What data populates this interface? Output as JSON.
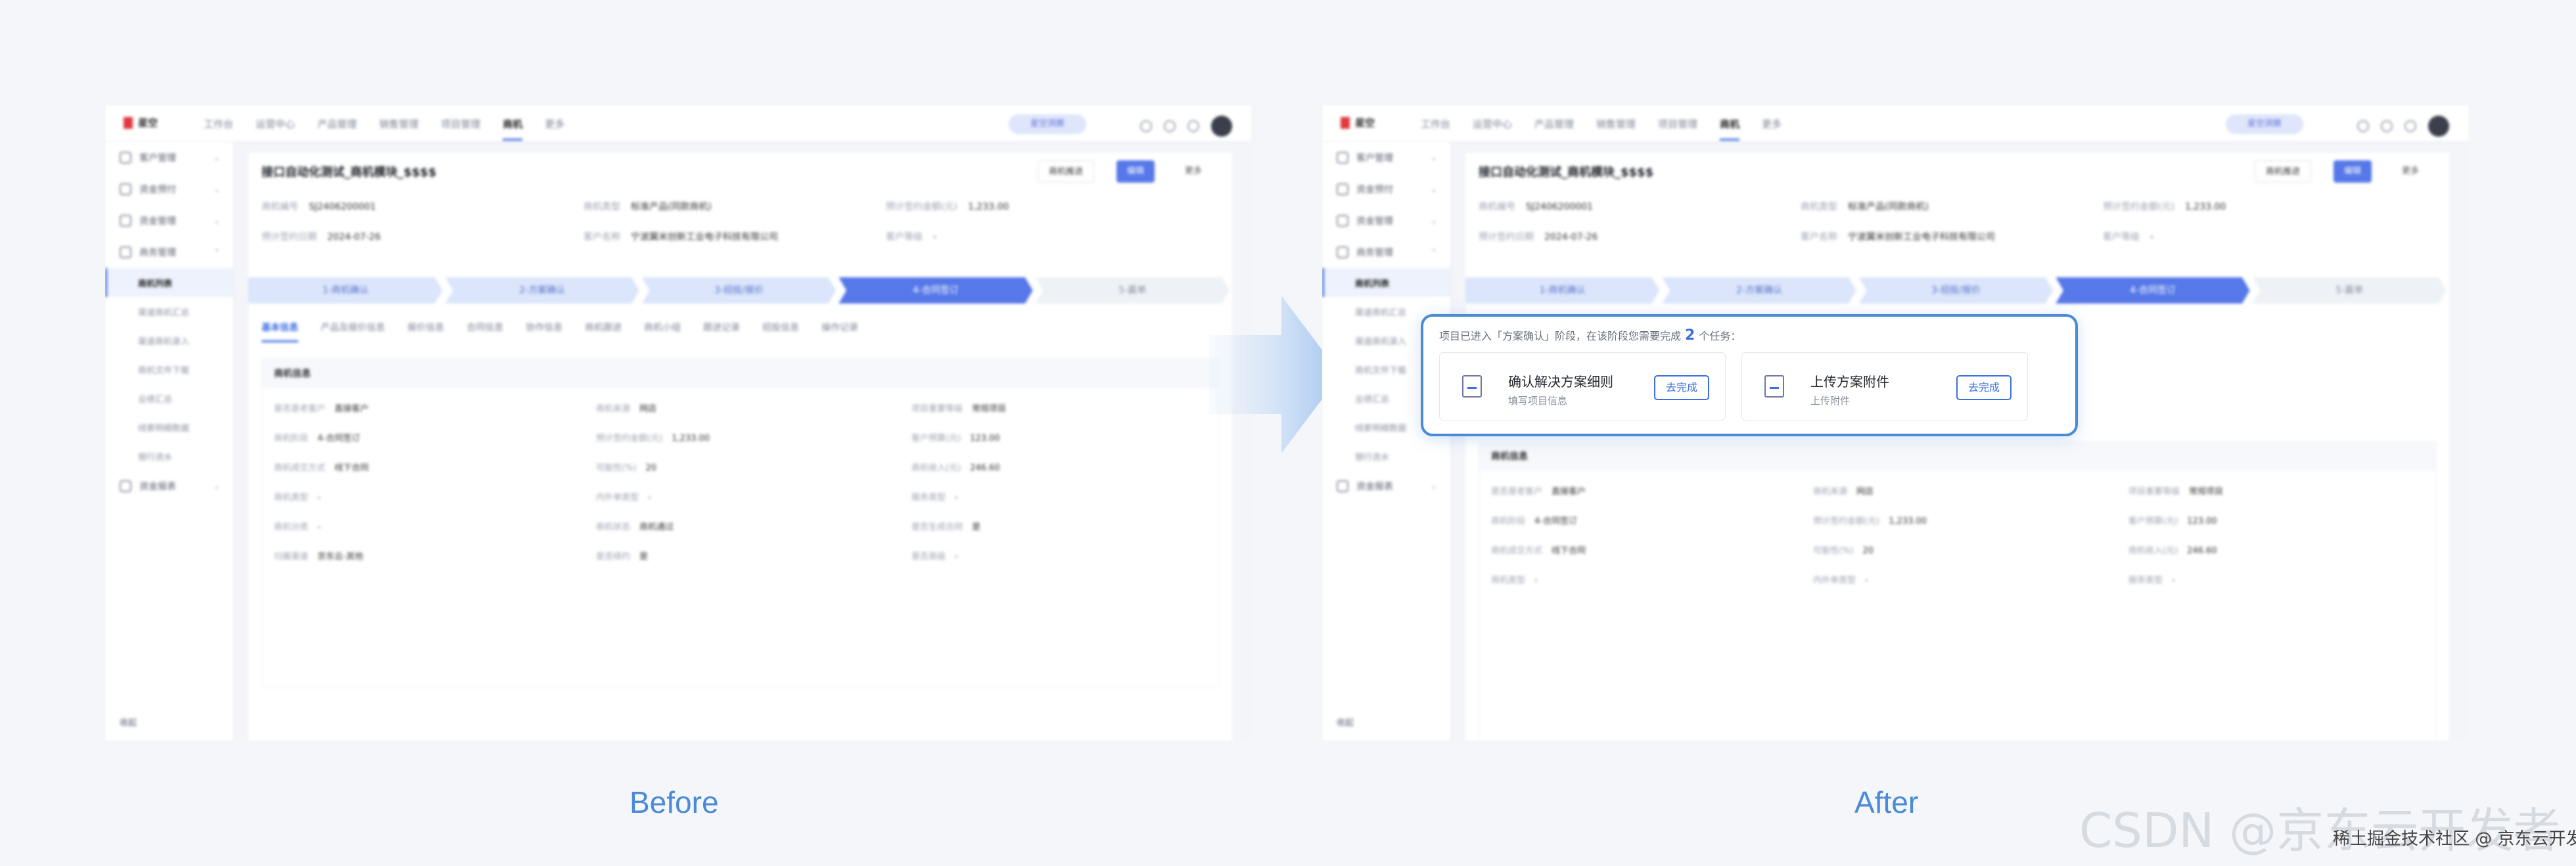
{
  "app": {
    "logo_text": "星空",
    "nav": [
      "工作台",
      "运营中心",
      "产品管理",
      "销售管理",
      "项目管理",
      "商机",
      "更多"
    ],
    "nav_active_index": 5,
    "top_badge": "星空洞察",
    "avatar_icon": "avatar",
    "top_icons": [
      "bell-icon",
      "help-icon",
      "settings-icon"
    ]
  },
  "sidebar": {
    "items": [
      {
        "label": "客户管理",
        "icon": "user-icon"
      },
      {
        "label": "资金预付",
        "icon": "wallet-icon"
      },
      {
        "label": "资金管理",
        "icon": "money-icon"
      },
      {
        "label": "商务管理",
        "icon": "briefcase-icon"
      }
    ],
    "subitems": [
      "商机列表",
      "渠道商机汇总",
      "渠道商机录入",
      "商机文件下载",
      "业绩汇总",
      "线索明细数据",
      "银行流水"
    ],
    "subitems_active_index": 0,
    "extra_item": {
      "label": "资金报表",
      "icon": "report-icon"
    },
    "footer": "收起"
  },
  "detail": {
    "title": "接口自动化测试_商机模块_$$$$",
    "buttons": [
      "商机推进",
      "编辑",
      "更多"
    ],
    "info": [
      {
        "label": "商机编号",
        "value": "SJ2406200001"
      },
      {
        "label": "商机类型",
        "value": "标准产品(同款商机)"
      },
      {
        "label": "预计签约金额(元)",
        "value": "1,233.00"
      },
      {
        "label": "预计签约日期",
        "value": "2024-07-26"
      },
      {
        "label": "客户名称",
        "value": "宁波翼米创新工业电子科技有限公司"
      },
      {
        "label": "客户等级",
        "value": "-"
      }
    ],
    "steps": [
      "1-商机确认",
      "2-方案确认",
      "3-招投/报价",
      "4-合同签订",
      "5-赢单"
    ],
    "current_step_index": 3,
    "tabs": [
      "基本信息",
      "产品及报价信息",
      "报价信息",
      "合同信息",
      "协作信息",
      "商机跟进",
      "商机小组",
      "跟进记录",
      "招投信息",
      "操作记录"
    ],
    "section_title": "商机信息",
    "fields": [
      {
        "label": "是否是老客户",
        "value": "直接客户"
      },
      {
        "label": "商机来源",
        "value": "网店"
      },
      {
        "label": "项目重要等级",
        "value": "常规项目"
      },
      {
        "label": "商机阶段",
        "value": "4-合同签订"
      },
      {
        "label": "预计签约金额(元)",
        "value": "1,233.00"
      },
      {
        "label": "客户预算(元)",
        "value": "123.00"
      },
      {
        "label": "商机成交方式",
        "value": "线下合同"
      },
      {
        "label": "可能性(%)",
        "value": "20"
      },
      {
        "label": "商机收入(元)",
        "value": "246.60"
      },
      {
        "label": "商机类型",
        "value": "-"
      },
      {
        "label": "内外单类型",
        "value": "-"
      },
      {
        "label": "服务类型",
        "value": "-"
      },
      {
        "label": "商机分类",
        "value": "-"
      },
      {
        "label": "商机状态",
        "value": "商机通过"
      },
      {
        "label": "是否生成合同",
        "value": "是"
      },
      {
        "label": "归属渠道",
        "value": "京东云-其他"
      },
      {
        "label": "是否续约",
        "value": "是"
      },
      {
        "label": "是否高级",
        "value": "-"
      }
    ]
  },
  "popup": {
    "message_prefix": "项目已进入「方案确认」阶段，在该阶段您需要完成",
    "count": "2",
    "message_suffix": "个任务：",
    "tasks": [
      {
        "title": "确认解决方案细则",
        "subtitle": "填写项目信息",
        "button": "去完成",
        "icon": "form-edit-icon"
      },
      {
        "title": "上传方案附件",
        "subtitle": "上传附件",
        "button": "去完成",
        "icon": "file-upload-icon"
      }
    ]
  },
  "captions": {
    "before": "Before",
    "after": "After"
  },
  "watermark": {
    "large": "CSDN @京东云开发者",
    "small": "稀土掘金技术社区 @ 京东云开发者"
  },
  "colors": {
    "accent": "#3d6fe0",
    "caption": "#4a8ad6",
    "popup_border": "#4a8ad6",
    "arrow": "#bcd6f3"
  }
}
